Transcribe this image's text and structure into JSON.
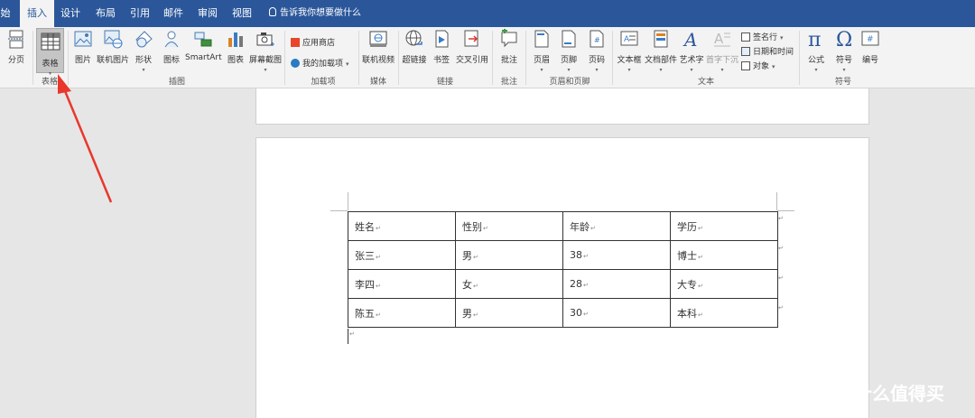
{
  "tabs": [
    {
      "label": "开始",
      "visible": "始"
    },
    {
      "label": "插入",
      "active": true
    },
    {
      "label": "设计"
    },
    {
      "label": "布局"
    },
    {
      "label": "引用"
    },
    {
      "label": "邮件"
    },
    {
      "label": "审阅"
    },
    {
      "label": "视图"
    }
  ],
  "tell_me": "告诉我你想要做什么",
  "ribbon": {
    "page_break": "分页",
    "table": "表格",
    "groups": {
      "tables": "表格",
      "illustrations": "插图",
      "addins": "加载项",
      "media": "媒体",
      "links": "链接",
      "comments": "批注",
      "header_footer": "页眉和页脚",
      "text": "文本",
      "symbols": "符号"
    },
    "illustrations": [
      "图片",
      "联机图片",
      "形状",
      "图标",
      "SmartArt",
      "图表",
      "屏幕截图"
    ],
    "addins": {
      "store": "应用商店",
      "my_addins": "我的加载项"
    },
    "online_video": "联机视频",
    "links": [
      "超链接",
      "书签",
      "交叉引用"
    ],
    "comment": "批注",
    "header": "页眉",
    "footer": "页脚",
    "page_number": "页码",
    "text_items": [
      "文本框",
      "文档部件",
      "艺术字",
      "首字下沉"
    ],
    "signature_line": "签名行",
    "date_time": "日期和时间",
    "object": "对象",
    "equation": "公式",
    "symbol": "符号",
    "numbering": "编号"
  },
  "document": {
    "table": {
      "rows": [
        [
          "姓名",
          "性别",
          "年龄",
          "学历"
        ],
        [
          "张三",
          "男",
          "38",
          "博士"
        ],
        [
          "李四",
          "女",
          "28",
          "大专"
        ],
        [
          "陈五",
          "男",
          "30",
          "本科"
        ]
      ]
    },
    "paragraph_mark": "↵"
  },
  "watermark": "什么值得买",
  "colors": {
    "title_bar": "#2b579a",
    "ribbon_bg": "#f3f3f3",
    "arrow": "#e8382b"
  }
}
